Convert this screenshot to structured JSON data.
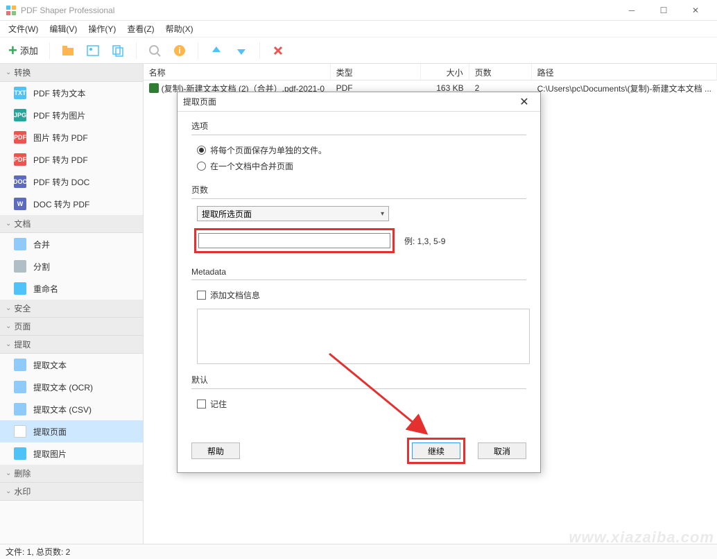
{
  "app": {
    "title": "PDF Shaper Professional"
  },
  "menu": {
    "file": "文件(W)",
    "edit": "编辑(V)",
    "action": "操作(Y)",
    "view": "查看(Z)",
    "help": "帮助(X)"
  },
  "toolbar": {
    "add": "添加"
  },
  "sidebar": {
    "groups": {
      "convert": "转换",
      "document": "文档",
      "security": "安全",
      "page": "页面",
      "extract": "提取",
      "delete": "删除",
      "watermark": "水印"
    },
    "convert_items": [
      "PDF 转为文本",
      "PDF 转为图片",
      "图片 转为 PDF",
      "PDF 转为 PDF",
      "PDF 转为 DOC",
      "DOC 转为 PDF"
    ],
    "document_items": [
      "合并",
      "分割",
      "重命名"
    ],
    "extract_items": [
      "提取文本",
      "提取文本 (OCR)",
      "提取文本 (CSV)",
      "提取页面",
      "提取图片"
    ]
  },
  "table": {
    "headers": {
      "name": "名称",
      "type": "类型",
      "size": "大小",
      "pages": "页数",
      "path": "路径"
    },
    "row": {
      "name": "(复制)-新建文本文档 (2)（合并）.pdf-2021-0",
      "type": "PDF",
      "size": "163 KB",
      "pages": "2",
      "path": "C:\\Users\\pc\\Documents\\(复制)-新建文本文档 ..."
    }
  },
  "dialog": {
    "title": "提取页面",
    "options_label": "选项",
    "opt1": "将每个页面保存为单独的文件。",
    "opt2": "在一个文档中合并页面",
    "pages_label": "页数",
    "select_value": "提取所选页面",
    "example": "例: 1,3, 5-9",
    "metadata_label": "Metadata",
    "add_meta": "添加文档信息",
    "default_label": "默认",
    "remember": "记住",
    "help": "帮助",
    "continue": "继续",
    "cancel": "取消"
  },
  "statusbar": {
    "text": "文件: 1, 总页数: 2"
  },
  "watermark": "www.xiazaiba.com"
}
